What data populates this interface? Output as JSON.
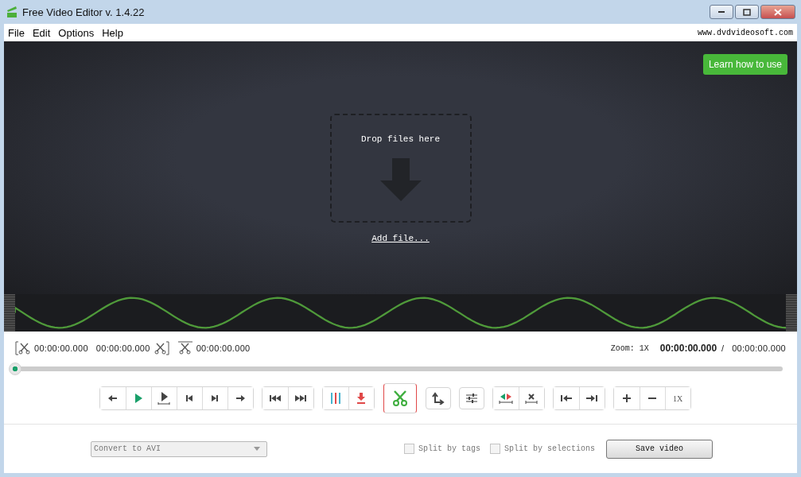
{
  "window": {
    "title": "Free Video Editor v. 1.4.22"
  },
  "menu": [
    "File",
    "Edit",
    "Options",
    "Help"
  ],
  "site_link": "www.dvdvideosoft.com",
  "learn_button": "Learn how to use",
  "drop_zone": {
    "text": "Drop files here",
    "add_link": "Add file..."
  },
  "times": {
    "start": "00:00:00.000",
    "end": "00:00:00.000",
    "selection": "00:00:00.000",
    "zoom": "Zoom: 1X",
    "current": "00:00:00.000",
    "separator": "/",
    "total": "00:00:00.000"
  },
  "position_slider": {
    "level": 0
  },
  "toolbar": [
    [
      {
        "kind": "prev-frame"
      },
      {
        "kind": "play"
      },
      {
        "kind": "play-selection"
      },
      {
        "kind": "step-back"
      },
      {
        "kind": "step-forward"
      },
      {
        "kind": "next-frame"
      }
    ],
    [
      {
        "kind": "skip-back"
      },
      {
        "kind": "skip-forward"
      }
    ],
    [
      {
        "kind": "split-marks"
      },
      {
        "kind": "marker-down"
      }
    ],
    [
      {
        "kind": "cut"
      }
    ],
    [
      {
        "kind": "rotate"
      }
    ],
    [
      {
        "kind": "adjust"
      }
    ],
    [
      {
        "kind": "mark-selection"
      },
      {
        "kind": "delete-selection"
      }
    ],
    [
      {
        "kind": "go-start"
      },
      {
        "kind": "go-end"
      }
    ],
    [
      {
        "kind": "zoom-in"
      },
      {
        "kind": "zoom-out"
      },
      {
        "kind": "zoom-reset",
        "label": "1X"
      }
    ]
  ],
  "format_dropdown": {
    "value": "Convert to AVI",
    "disabled": true
  },
  "options": [
    {
      "label": "Split by tags",
      "checked": false,
      "disabled": true
    },
    {
      "label": "Split by selections",
      "checked": false,
      "disabled": true
    }
  ],
  "save_button": "Save video"
}
